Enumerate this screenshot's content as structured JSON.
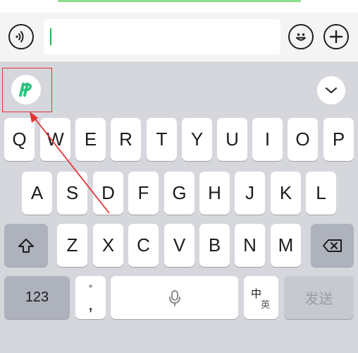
{
  "keyboard": {
    "row1": [
      "Q",
      "W",
      "E",
      "R",
      "T",
      "Y",
      "U",
      "I",
      "O",
      "P"
    ],
    "row2": [
      "A",
      "S",
      "D",
      "F",
      "G",
      "H",
      "J",
      "K",
      "L"
    ],
    "row3": [
      "Z",
      "X",
      "C",
      "V",
      "B",
      "N",
      "M"
    ],
    "bottom": {
      "numbers_label": "123",
      "punct_top": "°",
      "punct_main": ",",
      "lang_primary": "中",
      "lang_secondary": "英",
      "send_label": "发送"
    }
  },
  "colors": {
    "caret": "#1fbb55",
    "highlight_box": "#e53333",
    "app_icon": "#2bc57f",
    "send_text": "#9a9ba1"
  },
  "icons": {
    "voice": "voice-icon",
    "emoji": "emoji-icon",
    "plus": "plus-icon",
    "app": "app-logo-icon",
    "collapse": "chevron-down-icon",
    "shift": "shift-icon",
    "backspace": "backspace-icon",
    "mic": "microphone-icon"
  }
}
